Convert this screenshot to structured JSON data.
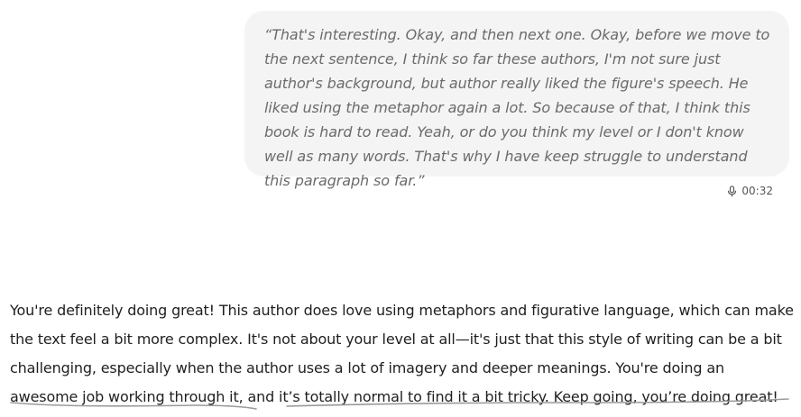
{
  "user_message": {
    "text": "“That's interesting. Okay, and then next one. Okay, before we move to the next sentence, I think so far these authors, I'm not sure just author's background, but author really liked the figure's speech. He liked using the metaphor again a lot. So because of that, I think this book is hard to read. Yeah, or do you think my level or I don't know well as many words. That's why I have keep struggle to understand this paragraph so far.”",
    "voice_icon": "microphone-icon",
    "duration": "00:32"
  },
  "assistant_message": {
    "text": "You're definitely doing great! This author does love using metaphors and figurative language, which can make the text feel a bit more complex. It's not about your level at all—it's just that this style of writing can be a bit challenging, especially when the author uses a lot of imagery and deeper meanings. You're doing an awesome job working through it, and it’s totally normal to find it a bit tricky. Keep going, you’re doing great!"
  },
  "colors": {
    "bubble_bg": "#f4f4f4",
    "user_text": "#6b6b6b",
    "assistant_text": "#1f1f1f",
    "scribble": "#9a9a9a"
  }
}
